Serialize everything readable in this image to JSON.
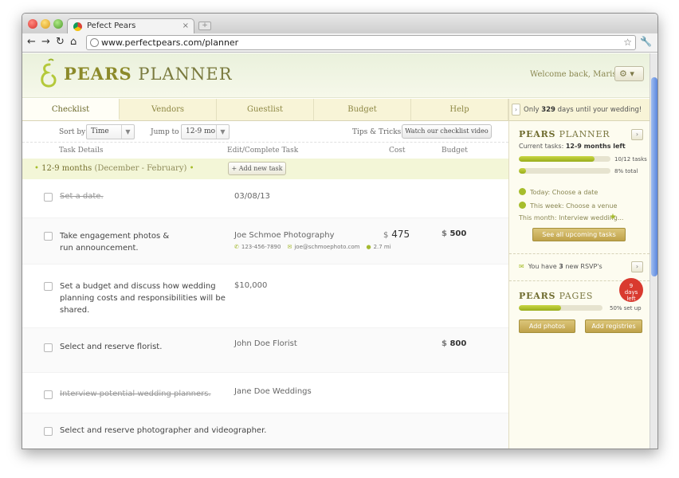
{
  "browser": {
    "tab_title": "Pefect Pears",
    "tab_close": "×",
    "new_tab": "+",
    "url": "www.perfectpears.com/planner"
  },
  "header": {
    "logo_bold": "PEARS",
    "logo_light": "PLANNER",
    "welcome": "Welcome back, Marissa",
    "settings_caret": "▾"
  },
  "tabs": [
    "Checklist",
    "Vendors",
    "Guestlist",
    "Budget",
    "Help"
  ],
  "controls": {
    "sort_label": "Sort by",
    "sort_value": "Time",
    "jump_label": "Jump to",
    "jump_value": "12-9 mo",
    "tips_label": "Tips & Tricks",
    "video_button": "Watch our checklist video"
  },
  "columns": {
    "task": "Task Details",
    "edit": "Edit/Complete Task",
    "cost": "Cost",
    "budget": "Budget"
  },
  "period": {
    "label": "12-9 months",
    "range": "(December - February)",
    "add_button": "+ Add new task"
  },
  "tasks": [
    {
      "name": "Set a date.",
      "done": true,
      "detail": "03/08/13",
      "cost": "",
      "budget": ""
    },
    {
      "name": "Take engagement photos & run announcement.",
      "done": false,
      "detail": "Joe Schmoe Photography",
      "phone": "123-456-7890",
      "email": "joe@schmoephoto.com",
      "distance": "2.7 mi",
      "cost": "475",
      "budget": "500"
    },
    {
      "name": "Set a budget and discuss how wedding planning costs and responsibilities will be shared.",
      "done": false,
      "detail": "$10,000",
      "cost": "",
      "budget": ""
    },
    {
      "name": "Select and reserve florist.",
      "done": false,
      "detail": "John Doe Florist",
      "cost": "",
      "budget": "800"
    },
    {
      "name": "Interview potential wedding planners.",
      "done": true,
      "detail": "Jane Doe Weddings",
      "cost": "",
      "budget": ""
    },
    {
      "name": "Select and reserve photographer and videographer.",
      "done": false,
      "detail": "",
      "cost": "",
      "budget": ""
    }
  ],
  "currency": "$",
  "sidebar": {
    "countdown_pre": "Only",
    "countdown_days": "329",
    "countdown_post": "days until your wedding!",
    "planner_bold": "PEARS",
    "planner_light": "PLANNER",
    "current_label": "Current tasks:",
    "current_value": "12-9 months left",
    "progress_tasks": {
      "label": "10/12 tasks",
      "fraction": 0.83
    },
    "progress_total": {
      "label": "8% total",
      "fraction": 0.08
    },
    "today": "Today: Choose a date",
    "week": "This week: Choose a venue",
    "month": "This month: Interview wedding...",
    "upcoming_button": "See all upcoming tasks",
    "rsvp_pre": "You have",
    "rsvp_count": "3",
    "rsvp_post": "new RSVP's",
    "pages_bold": "PEARS",
    "pages_light": "PAGES",
    "ribbon_num": "9",
    "ribbon_text": "days left",
    "pages_progress": {
      "label": "50% set up",
      "fraction": 0.5
    },
    "add_photos": "Add photos",
    "add_registries": "Add registries"
  }
}
